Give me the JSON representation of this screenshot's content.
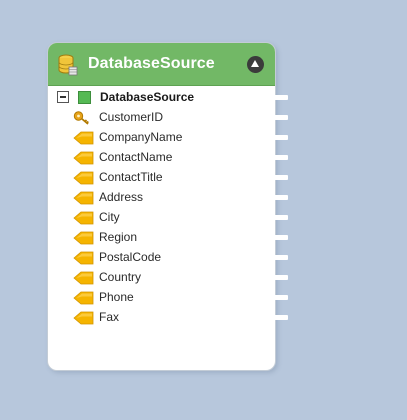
{
  "node": {
    "title": "DatabaseSource",
    "icon": "database-icon",
    "collapse_icon": "collapse-up-icon",
    "root": {
      "label": "DatabaseSource",
      "toggle_icon": "collapse-minus-icon",
      "icon": "table-icon"
    },
    "fields": [
      {
        "label": "CustomerID",
        "icon": "key-icon"
      },
      {
        "label": "CompanyName",
        "icon": "field-arrow-icon"
      },
      {
        "label": "ContactName",
        "icon": "field-arrow-icon"
      },
      {
        "label": "ContactTitle",
        "icon": "field-arrow-icon"
      },
      {
        "label": "Address",
        "icon": "field-arrow-icon"
      },
      {
        "label": "City",
        "icon": "field-arrow-icon"
      },
      {
        "label": "Region",
        "icon": "field-arrow-icon"
      },
      {
        "label": "PostalCode",
        "icon": "field-arrow-icon"
      },
      {
        "label": "Country",
        "icon": "field-arrow-icon"
      },
      {
        "label": "Phone",
        "icon": "field-arrow-icon"
      },
      {
        "label": "Fax",
        "icon": "field-arrow-icon"
      }
    ]
  },
  "colors": {
    "canvas": "#b7c7dc",
    "header": "#72b866",
    "field_icon": "#f5b400",
    "key_icon": "#e8a31a",
    "table_icon": "#55b954"
  }
}
